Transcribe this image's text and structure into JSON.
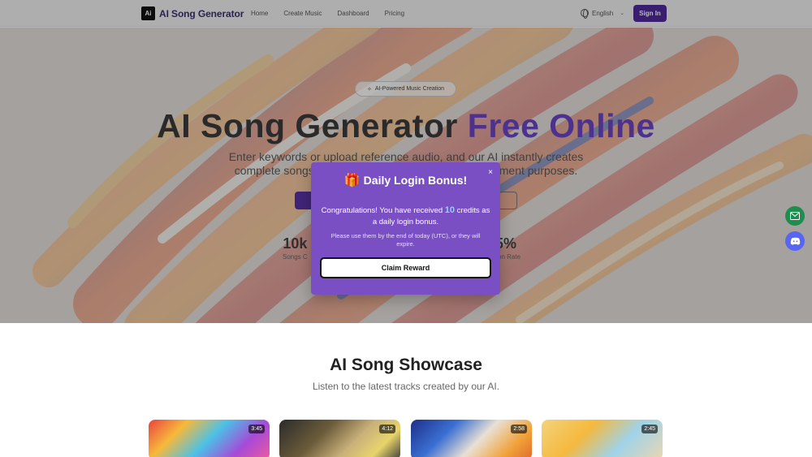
{
  "header": {
    "logo_mark": "Ai",
    "app_name": "AI Song Generator",
    "nav": [
      "Home",
      "Create Music",
      "Dashboard",
      "Pricing"
    ],
    "language": "English",
    "sign_in": "Sign In"
  },
  "hero": {
    "badge": "AI-Powered Music Creation",
    "title_main": "AI Song Generator",
    "title_accent": "Free Online",
    "subtitle": "Enter keywords or upload reference audio, and our AI instantly creates complete songs for personal or commercial entertainment purposes.",
    "stats": [
      {
        "value": "10k",
        "label": "Songs C"
      },
      {
        "value": "5%",
        "label": "ction Rate"
      }
    ]
  },
  "modal": {
    "icon": "gift-icon",
    "title": "Daily Login Bonus!",
    "message_prefix": "Congratulations! You have received",
    "credits": "10",
    "message_suffix": "credits as a daily login bonus.",
    "note": "Please use them by the end of today (UTC), or they will expire.",
    "button": "Claim Reward",
    "close": "×"
  },
  "showcase": {
    "title": "AI Song Showcase",
    "subtitle": "Listen to the latest tracks created by our AI.",
    "cards": [
      {
        "duration": "3:45"
      },
      {
        "duration": "4:12"
      },
      {
        "duration": "2:58"
      },
      {
        "duration": "2:45"
      }
    ]
  },
  "colors": {
    "brand": "#5a32a8",
    "modal_bg": "#7a4fc4",
    "credits": "#8fd3ff",
    "mail_btn": "#1f8e4d",
    "discord_btn": "#5865f2"
  }
}
